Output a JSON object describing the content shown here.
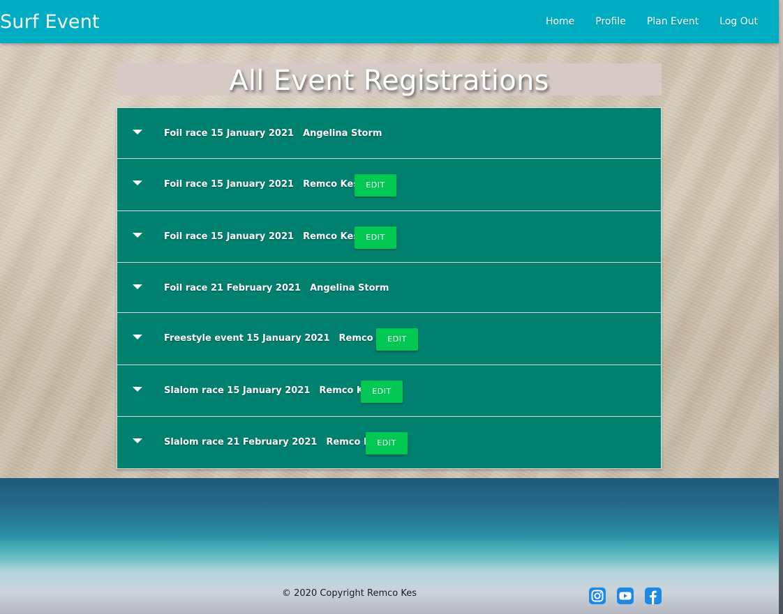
{
  "navbar": {
    "brand": "Surf Event",
    "links": [
      {
        "label": "Home"
      },
      {
        "label": "Profile"
      },
      {
        "label": "Plan Event"
      },
      {
        "label": "Log Out"
      }
    ]
  },
  "page": {
    "title": "All Event Registrations"
  },
  "registrations": [
    {
      "event": "Foil race 15 January 2021",
      "user": "Angelina Storm",
      "edit": ""
    },
    {
      "event": "Foil race 15 January 2021",
      "user": "Remco Kes 2",
      "edit": "EDIT"
    },
    {
      "event": "Foil race 15 January 2021",
      "user": "Remco Kes 2",
      "edit": "EDIT"
    },
    {
      "event": "Foil race 21 February 2021",
      "user": "Angelina Storm",
      "edit": ""
    },
    {
      "event": "Freestyle event 15 January 2021",
      "user": "Remco Kes",
      "edit": "EDIT"
    },
    {
      "event": "Slalom race 15 January 2021",
      "user": "Remco Kes",
      "edit": "EDIT"
    },
    {
      "event": "Slalom race 21 February 2021",
      "user": "Remco Kes",
      "edit": "EDIT"
    }
  ],
  "footer": {
    "copyright": "© 2020 Copyright Remco Kes",
    "social": [
      {
        "icon": "instagram-icon",
        "color": "#1e88e5"
      },
      {
        "icon": "youtube-icon",
        "color": "#1e88e5"
      },
      {
        "icon": "facebook-icon",
        "color": "#1e88e5"
      }
    ]
  },
  "colors": {
    "navbar": "#00acc1",
    "list_item": "#00806f",
    "edit_button": "#00c853",
    "title_banner": "#d5cbc4"
  }
}
